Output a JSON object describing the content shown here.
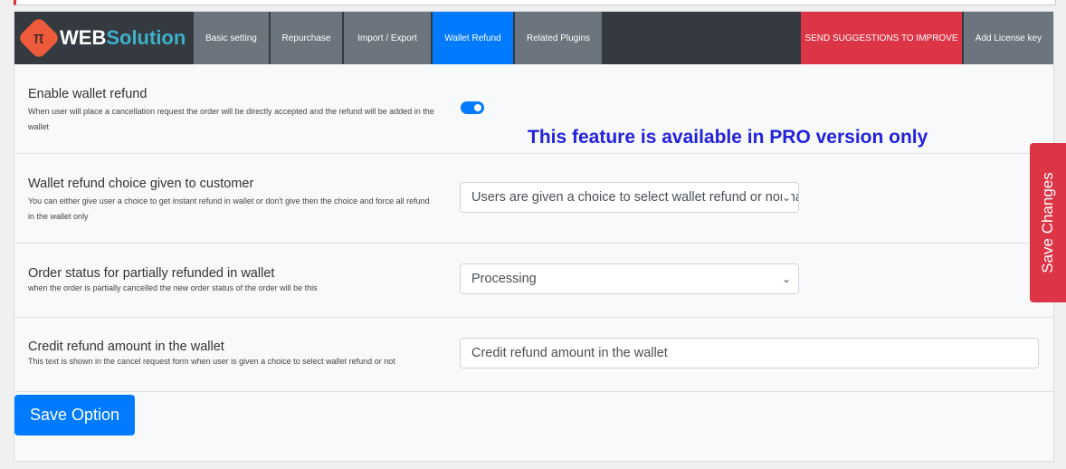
{
  "logo": {
    "text_a": "WEB",
    "text_b": "Solution",
    "glyph": "π"
  },
  "tabs": [
    {
      "label": "Basic setting"
    },
    {
      "label": "Repurchase"
    },
    {
      "label": "Import / Export"
    },
    {
      "label": "Wallet Refund",
      "active": true
    },
    {
      "label": "Related Plugins"
    }
  ],
  "suggest_label": "SEND SUGGESTIONS TO IMPROVE",
  "license_label": "Add License key",
  "pro_notice": "This feature is available in PRO version only",
  "settings": [
    {
      "title": "Enable wallet refund",
      "desc": "When user will place a cancellation request the order will be directly accepted and the refund will be added in the wallet",
      "enabled": true
    },
    {
      "title": "Wallet refund choice given to customer",
      "desc": "You can either give user a choice to get instant refund in wallet or don't give then the choice and force all refund in the wallet only",
      "value": "Users are given a choice to select wallet refund or normal refund"
    },
    {
      "title": "Order status for partially refunded in wallet",
      "desc": "when the order is partially cancelled the new order status of the order will be this",
      "value": "Processing"
    },
    {
      "title": "Credit refund amount in the wallet",
      "desc": "This text is shown in the cancel request form when user is given a choice to select wallet refund or not",
      "value": "Credit refund amount in the wallet"
    }
  ],
  "save_option": "Save Option",
  "save_changes": "Save Changes",
  "colors": {
    "primary": "#007bff",
    "danger": "#dc3545",
    "nav": "#343a40",
    "tab": "#6c757d",
    "pro": "#2222dd"
  }
}
